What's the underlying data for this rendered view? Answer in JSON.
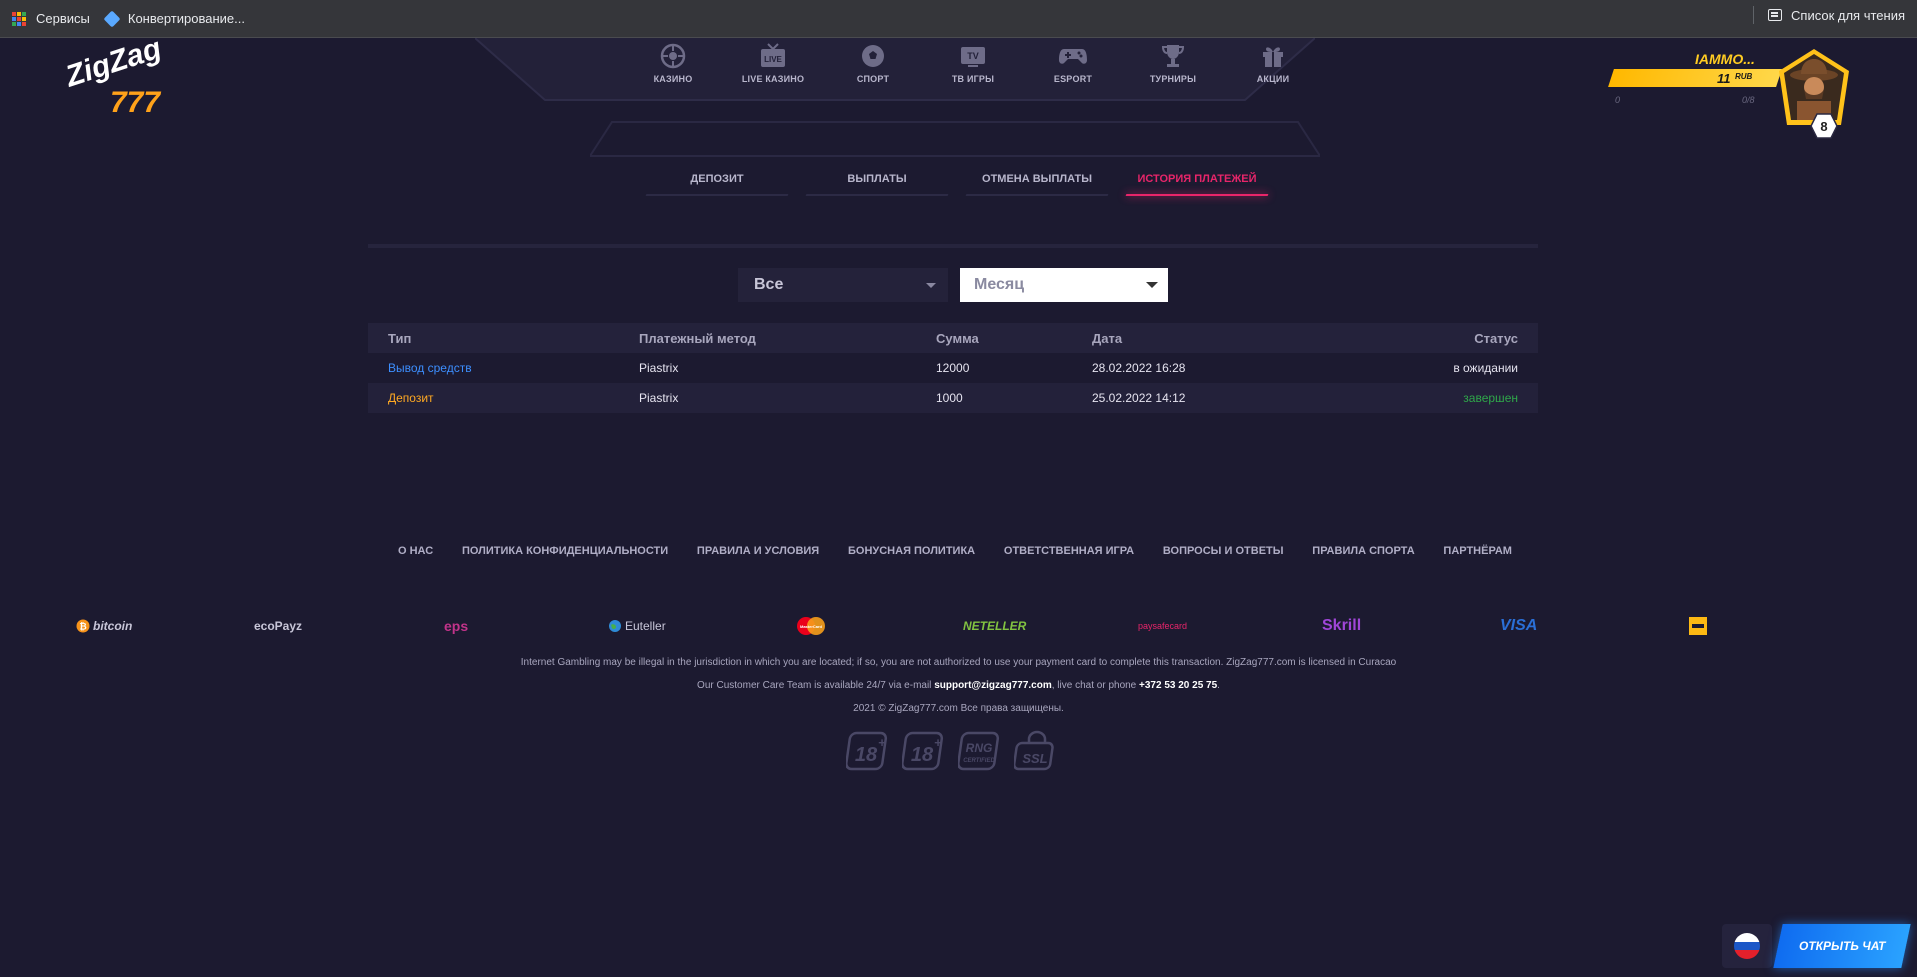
{
  "browser": {
    "bookmarks": [
      {
        "label": "Сервисы",
        "icon": "apps-grid-icon"
      },
      {
        "label": "Конвертирование..."
      }
    ],
    "reading_list_label": "Список для чтения"
  },
  "brand": {
    "logo_line1": "ZigZag",
    "logo_line2": "777"
  },
  "nav": [
    {
      "label": "КАЗИНО",
      "icon": "roulette-icon"
    },
    {
      "label": "LIVE КАЗИНО",
      "icon": "live-tv-icon"
    },
    {
      "label": "СПОРТ",
      "icon": "soccer-ball-icon"
    },
    {
      "label": "ТВ ИГРЫ",
      "icon": "tv-icon"
    },
    {
      "label": "ESPORT",
      "icon": "gamepad-icon"
    },
    {
      "label": "ТУРНИРЫ",
      "icon": "trophy-icon"
    },
    {
      "label": "АКЦИИ",
      "icon": "gift-icon"
    }
  ],
  "tabs": [
    {
      "label": "ДЕПОЗИТ",
      "active": false
    },
    {
      "label": "ВЫПЛАТЫ",
      "active": false
    },
    {
      "label": "ОТМЕНА ВЫПЛАТЫ",
      "active": false
    },
    {
      "label": "ИСТОРИЯ ПЛАТЕЖЕЙ",
      "active": true
    }
  ],
  "profile": {
    "name": "IAMMO...",
    "balance": "11",
    "currency": "RUB",
    "progress_min": "0",
    "progress_max": "0/8",
    "level": "8"
  },
  "filters": {
    "type": "Все",
    "period": "Месяц"
  },
  "table": {
    "headers": {
      "type": "Тип",
      "method": "Платежный метод",
      "sum": "Сумма",
      "date": "Дата",
      "status": "Статус"
    },
    "rows": [
      {
        "type": "Вывод средств",
        "method": "Piastrix",
        "sum": "12000",
        "date": "28.02.2022 16:28",
        "status": "в ожидании"
      },
      {
        "type": "Депозит",
        "method": "Piastrix",
        "sum": "1000",
        "date": "25.02.2022 14:12",
        "status": "завершен"
      }
    ]
  },
  "footer": {
    "links": [
      "О НАС",
      "ПОЛИТИКА КОНФИДЕНЦИАЛЬНОСТИ",
      "ПРАВИЛА И УСЛОВИЯ",
      "БОНУСНАЯ ПОЛИТИКА",
      "ОТВЕТСТВЕННАЯ ИГРА",
      "ВОПРОСЫ И ОТВЕТЫ",
      "ПРАВИЛА СПОРТА",
      "ПАРТНЁРАМ"
    ],
    "payments": {
      "bitcoin": "bitcoin",
      "ecopayz": "ecoPayz",
      "eps": "eps",
      "euteller": "Euteller",
      "mastercard": "MasterCard",
      "neteller": "NETELLER",
      "paysafecard": "paysafecard",
      "skrill": "Skrill",
      "visa": "VISA"
    },
    "legal_line": "Internet Gambling may be illegal in the jurisdiction in which you are located; if so, you are not authorized to use your payment card to complete this transaction. ZigZag777.com is licensed in Curacao",
    "care_prefix": "Our Customer Care Team is available 24/7 via e-mail ",
    "care_email": "support@zigzag777.com",
    "care_middle": ", live chat or phone ",
    "care_phone": "+372 53 20 25 75",
    "care_suffix": ".",
    "copyright": "2021 © ZigZag777.com Все права защищены.",
    "badges": [
      {
        "main": "18",
        "sub": "+"
      },
      {
        "main": "18",
        "sub": "+"
      },
      {
        "main": "RNG",
        "sub": "CERTIFIED"
      },
      {
        "main": "SSL",
        "sub": ""
      }
    ]
  },
  "chat": {
    "label": "ОТКРЫТЬ ЧАТ"
  },
  "colors": {
    "accent": "#e8256a",
    "withdraw": "#3d8fff",
    "deposit": "#ffa922",
    "completed": "#2fa84a",
    "balance_bar": "#ffc21a",
    "chat": "#1a86ff"
  }
}
